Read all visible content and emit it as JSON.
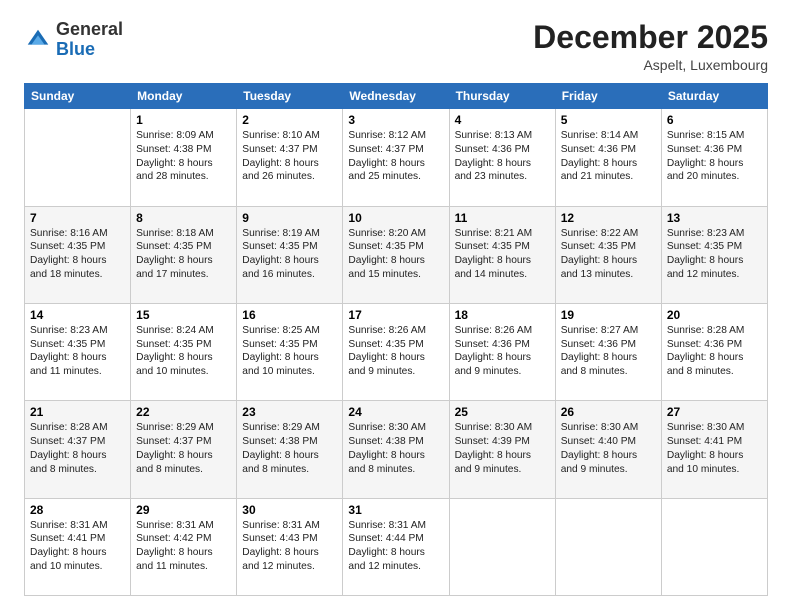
{
  "logo": {
    "general": "General",
    "blue": "Blue"
  },
  "header": {
    "month": "December 2025",
    "location": "Aspelt, Luxembourg"
  },
  "days": [
    "Sunday",
    "Monday",
    "Tuesday",
    "Wednesday",
    "Thursday",
    "Friday",
    "Saturday"
  ],
  "weeks": [
    [
      {
        "date": "",
        "sunrise": "",
        "sunset": "",
        "daylight": ""
      },
      {
        "date": "1",
        "sunrise": "Sunrise: 8:09 AM",
        "sunset": "Sunset: 4:38 PM",
        "daylight": "Daylight: 8 hours and 28 minutes."
      },
      {
        "date": "2",
        "sunrise": "Sunrise: 8:10 AM",
        "sunset": "Sunset: 4:37 PM",
        "daylight": "Daylight: 8 hours and 26 minutes."
      },
      {
        "date": "3",
        "sunrise": "Sunrise: 8:12 AM",
        "sunset": "Sunset: 4:37 PM",
        "daylight": "Daylight: 8 hours and 25 minutes."
      },
      {
        "date": "4",
        "sunrise": "Sunrise: 8:13 AM",
        "sunset": "Sunset: 4:36 PM",
        "daylight": "Daylight: 8 hours and 23 minutes."
      },
      {
        "date": "5",
        "sunrise": "Sunrise: 8:14 AM",
        "sunset": "Sunset: 4:36 PM",
        "daylight": "Daylight: 8 hours and 21 minutes."
      },
      {
        "date": "6",
        "sunrise": "Sunrise: 8:15 AM",
        "sunset": "Sunset: 4:36 PM",
        "daylight": "Daylight: 8 hours and 20 minutes."
      }
    ],
    [
      {
        "date": "7",
        "sunrise": "Sunrise: 8:16 AM",
        "sunset": "Sunset: 4:35 PM",
        "daylight": "Daylight: 8 hours and 18 minutes."
      },
      {
        "date": "8",
        "sunrise": "Sunrise: 8:18 AM",
        "sunset": "Sunset: 4:35 PM",
        "daylight": "Daylight: 8 hours and 17 minutes."
      },
      {
        "date": "9",
        "sunrise": "Sunrise: 8:19 AM",
        "sunset": "Sunset: 4:35 PM",
        "daylight": "Daylight: 8 hours and 16 minutes."
      },
      {
        "date": "10",
        "sunrise": "Sunrise: 8:20 AM",
        "sunset": "Sunset: 4:35 PM",
        "daylight": "Daylight: 8 hours and 15 minutes."
      },
      {
        "date": "11",
        "sunrise": "Sunrise: 8:21 AM",
        "sunset": "Sunset: 4:35 PM",
        "daylight": "Daylight: 8 hours and 14 minutes."
      },
      {
        "date": "12",
        "sunrise": "Sunrise: 8:22 AM",
        "sunset": "Sunset: 4:35 PM",
        "daylight": "Daylight: 8 hours and 13 minutes."
      },
      {
        "date": "13",
        "sunrise": "Sunrise: 8:23 AM",
        "sunset": "Sunset: 4:35 PM",
        "daylight": "Daylight: 8 hours and 12 minutes."
      }
    ],
    [
      {
        "date": "14",
        "sunrise": "Sunrise: 8:23 AM",
        "sunset": "Sunset: 4:35 PM",
        "daylight": "Daylight: 8 hours and 11 minutes."
      },
      {
        "date": "15",
        "sunrise": "Sunrise: 8:24 AM",
        "sunset": "Sunset: 4:35 PM",
        "daylight": "Daylight: 8 hours and 10 minutes."
      },
      {
        "date": "16",
        "sunrise": "Sunrise: 8:25 AM",
        "sunset": "Sunset: 4:35 PM",
        "daylight": "Daylight: 8 hours and 10 minutes."
      },
      {
        "date": "17",
        "sunrise": "Sunrise: 8:26 AM",
        "sunset": "Sunset: 4:35 PM",
        "daylight": "Daylight: 8 hours and 9 minutes."
      },
      {
        "date": "18",
        "sunrise": "Sunrise: 8:26 AM",
        "sunset": "Sunset: 4:36 PM",
        "daylight": "Daylight: 8 hours and 9 minutes."
      },
      {
        "date": "19",
        "sunrise": "Sunrise: 8:27 AM",
        "sunset": "Sunset: 4:36 PM",
        "daylight": "Daylight: 8 hours and 8 minutes."
      },
      {
        "date": "20",
        "sunrise": "Sunrise: 8:28 AM",
        "sunset": "Sunset: 4:36 PM",
        "daylight": "Daylight: 8 hours and 8 minutes."
      }
    ],
    [
      {
        "date": "21",
        "sunrise": "Sunrise: 8:28 AM",
        "sunset": "Sunset: 4:37 PM",
        "daylight": "Daylight: 8 hours and 8 minutes."
      },
      {
        "date": "22",
        "sunrise": "Sunrise: 8:29 AM",
        "sunset": "Sunset: 4:37 PM",
        "daylight": "Daylight: 8 hours and 8 minutes."
      },
      {
        "date": "23",
        "sunrise": "Sunrise: 8:29 AM",
        "sunset": "Sunset: 4:38 PM",
        "daylight": "Daylight: 8 hours and 8 minutes."
      },
      {
        "date": "24",
        "sunrise": "Sunrise: 8:30 AM",
        "sunset": "Sunset: 4:38 PM",
        "daylight": "Daylight: 8 hours and 8 minutes."
      },
      {
        "date": "25",
        "sunrise": "Sunrise: 8:30 AM",
        "sunset": "Sunset: 4:39 PM",
        "daylight": "Daylight: 8 hours and 9 minutes."
      },
      {
        "date": "26",
        "sunrise": "Sunrise: 8:30 AM",
        "sunset": "Sunset: 4:40 PM",
        "daylight": "Daylight: 8 hours and 9 minutes."
      },
      {
        "date": "27",
        "sunrise": "Sunrise: 8:30 AM",
        "sunset": "Sunset: 4:41 PM",
        "daylight": "Daylight: 8 hours and 10 minutes."
      }
    ],
    [
      {
        "date": "28",
        "sunrise": "Sunrise: 8:31 AM",
        "sunset": "Sunset: 4:41 PM",
        "daylight": "Daylight: 8 hours and 10 minutes."
      },
      {
        "date": "29",
        "sunrise": "Sunrise: 8:31 AM",
        "sunset": "Sunset: 4:42 PM",
        "daylight": "Daylight: 8 hours and 11 minutes."
      },
      {
        "date": "30",
        "sunrise": "Sunrise: 8:31 AM",
        "sunset": "Sunset: 4:43 PM",
        "daylight": "Daylight: 8 hours and 12 minutes."
      },
      {
        "date": "31",
        "sunrise": "Sunrise: 8:31 AM",
        "sunset": "Sunset: 4:44 PM",
        "daylight": "Daylight: 8 hours and 12 minutes."
      },
      {
        "date": "",
        "sunrise": "",
        "sunset": "",
        "daylight": ""
      },
      {
        "date": "",
        "sunrise": "",
        "sunset": "",
        "daylight": ""
      },
      {
        "date": "",
        "sunrise": "",
        "sunset": "",
        "daylight": ""
      }
    ]
  ]
}
